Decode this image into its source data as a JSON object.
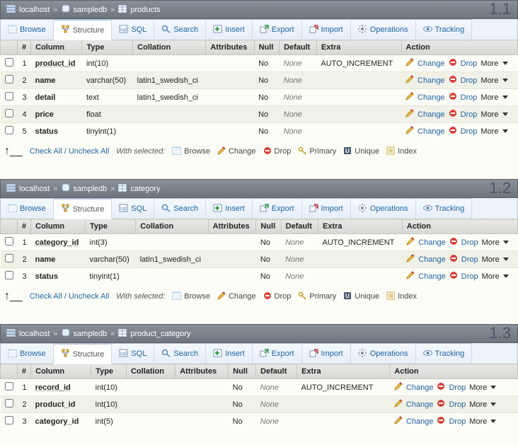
{
  "labels": {
    "tabs": {
      "browse": "Browse",
      "structure": "Structure",
      "sql": "SQL",
      "search": "Search",
      "insert": "Insert",
      "export": "Export",
      "import": "Import",
      "operations": "Operations",
      "tracking": "Tracking"
    },
    "headers": {
      "num": "#",
      "column": "Column",
      "type": "Type",
      "collation": "Collation",
      "attributes": "Attributes",
      "null": "Null",
      "default": "Default",
      "extra": "Extra",
      "action": "Action"
    },
    "actions": {
      "change": "Change",
      "drop": "Drop",
      "more": "More"
    },
    "footer": {
      "check": "Check All / Uncheck All",
      "ws": "With selected:",
      "browse": "Browse",
      "change": "Change",
      "drop": "Drop",
      "primary": "Primary",
      "unique": "Unique",
      "index": "Index"
    },
    "null_no": "No",
    "none": "None",
    "auto": "AUTO_INCREMENT"
  },
  "panels": [
    {
      "label": "1.1",
      "crumbs": [
        "localhost",
        "sampledb",
        "products"
      ],
      "rows": [
        {
          "n": 1,
          "col": "product_id",
          "key": true,
          "type": "int(10)",
          "coll": "",
          "nul": "No",
          "def": "None",
          "extra": "AUTO_INCREMENT"
        },
        {
          "n": 2,
          "col": "name",
          "key": false,
          "type": "varchar(50)",
          "coll": "latin1_swedish_ci",
          "nul": "No",
          "def": "None",
          "extra": ""
        },
        {
          "n": 3,
          "col": "detail",
          "key": false,
          "type": "text",
          "coll": "latin1_swedish_ci",
          "nul": "No",
          "def": "None",
          "extra": ""
        },
        {
          "n": 4,
          "col": "price",
          "key": false,
          "type": "float",
          "coll": "",
          "nul": "No",
          "def": "None",
          "extra": ""
        },
        {
          "n": 5,
          "col": "status",
          "key": false,
          "type": "tinyint(1)",
          "coll": "",
          "nul": "No",
          "def": "None",
          "extra": ""
        }
      ],
      "showFooter": true
    },
    {
      "label": "1.2",
      "crumbs": [
        "localhost",
        "sampledb",
        "category"
      ],
      "rows": [
        {
          "n": 1,
          "col": "category_id",
          "key": true,
          "type": "int(3)",
          "coll": "",
          "nul": "No",
          "def": "None",
          "extra": "AUTO_INCREMENT"
        },
        {
          "n": 2,
          "col": "name",
          "key": false,
          "type": "varchar(50)",
          "coll": "latin1_swedish_ci",
          "nul": "No",
          "def": "None",
          "extra": ""
        },
        {
          "n": 3,
          "col": "status",
          "key": false,
          "type": "tinyint(1)",
          "coll": "",
          "nul": "No",
          "def": "None",
          "extra": ""
        }
      ],
      "showFooter": true
    },
    {
      "label": "1.3",
      "crumbs": [
        "localhost",
        "sampledb",
        "product_category"
      ],
      "rows": [
        {
          "n": 1,
          "col": "record_id",
          "key": true,
          "type": "int(10)",
          "coll": "",
          "nul": "No",
          "def": "None",
          "extra": "AUTO_INCREMENT"
        },
        {
          "n": 2,
          "col": "product_id",
          "key": false,
          "type": "int(10)",
          "coll": "",
          "nul": "No",
          "def": "None",
          "extra": ""
        },
        {
          "n": 3,
          "col": "category_id",
          "key": false,
          "type": "int(5)",
          "coll": "",
          "nul": "No",
          "def": "None",
          "extra": ""
        }
      ],
      "showFooter": false
    }
  ]
}
